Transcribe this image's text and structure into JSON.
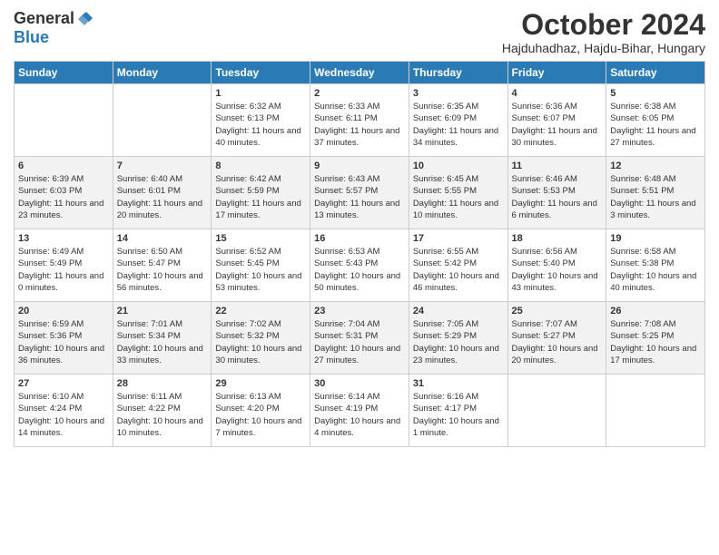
{
  "logo": {
    "general": "General",
    "blue": "Blue"
  },
  "title": {
    "month": "October 2024",
    "location": "Hajduhadhaz, Hajdu-Bihar, Hungary"
  },
  "days_of_week": [
    "Sunday",
    "Monday",
    "Tuesday",
    "Wednesday",
    "Thursday",
    "Friday",
    "Saturday"
  ],
  "weeks": [
    [
      {
        "date": "",
        "info": ""
      },
      {
        "date": "",
        "info": ""
      },
      {
        "date": "1",
        "info": "Sunrise: 6:32 AM\nSunset: 6:13 PM\nDaylight: 11 hours and 40 minutes."
      },
      {
        "date": "2",
        "info": "Sunrise: 6:33 AM\nSunset: 6:11 PM\nDaylight: 11 hours and 37 minutes."
      },
      {
        "date": "3",
        "info": "Sunrise: 6:35 AM\nSunset: 6:09 PM\nDaylight: 11 hours and 34 minutes."
      },
      {
        "date": "4",
        "info": "Sunrise: 6:36 AM\nSunset: 6:07 PM\nDaylight: 11 hours and 30 minutes."
      },
      {
        "date": "5",
        "info": "Sunrise: 6:38 AM\nSunset: 6:05 PM\nDaylight: 11 hours and 27 minutes."
      }
    ],
    [
      {
        "date": "6",
        "info": "Sunrise: 6:39 AM\nSunset: 6:03 PM\nDaylight: 11 hours and 23 minutes."
      },
      {
        "date": "7",
        "info": "Sunrise: 6:40 AM\nSunset: 6:01 PM\nDaylight: 11 hours and 20 minutes."
      },
      {
        "date": "8",
        "info": "Sunrise: 6:42 AM\nSunset: 5:59 PM\nDaylight: 11 hours and 17 minutes."
      },
      {
        "date": "9",
        "info": "Sunrise: 6:43 AM\nSunset: 5:57 PM\nDaylight: 11 hours and 13 minutes."
      },
      {
        "date": "10",
        "info": "Sunrise: 6:45 AM\nSunset: 5:55 PM\nDaylight: 11 hours and 10 minutes."
      },
      {
        "date": "11",
        "info": "Sunrise: 6:46 AM\nSunset: 5:53 PM\nDaylight: 11 hours and 6 minutes."
      },
      {
        "date": "12",
        "info": "Sunrise: 6:48 AM\nSunset: 5:51 PM\nDaylight: 11 hours and 3 minutes."
      }
    ],
    [
      {
        "date": "13",
        "info": "Sunrise: 6:49 AM\nSunset: 5:49 PM\nDaylight: 11 hours and 0 minutes."
      },
      {
        "date": "14",
        "info": "Sunrise: 6:50 AM\nSunset: 5:47 PM\nDaylight: 10 hours and 56 minutes."
      },
      {
        "date": "15",
        "info": "Sunrise: 6:52 AM\nSunset: 5:45 PM\nDaylight: 10 hours and 53 minutes."
      },
      {
        "date": "16",
        "info": "Sunrise: 6:53 AM\nSunset: 5:43 PM\nDaylight: 10 hours and 50 minutes."
      },
      {
        "date": "17",
        "info": "Sunrise: 6:55 AM\nSunset: 5:42 PM\nDaylight: 10 hours and 46 minutes."
      },
      {
        "date": "18",
        "info": "Sunrise: 6:56 AM\nSunset: 5:40 PM\nDaylight: 10 hours and 43 minutes."
      },
      {
        "date": "19",
        "info": "Sunrise: 6:58 AM\nSunset: 5:38 PM\nDaylight: 10 hours and 40 minutes."
      }
    ],
    [
      {
        "date": "20",
        "info": "Sunrise: 6:59 AM\nSunset: 5:36 PM\nDaylight: 10 hours and 36 minutes."
      },
      {
        "date": "21",
        "info": "Sunrise: 7:01 AM\nSunset: 5:34 PM\nDaylight: 10 hours and 33 minutes."
      },
      {
        "date": "22",
        "info": "Sunrise: 7:02 AM\nSunset: 5:32 PM\nDaylight: 10 hours and 30 minutes."
      },
      {
        "date": "23",
        "info": "Sunrise: 7:04 AM\nSunset: 5:31 PM\nDaylight: 10 hours and 27 minutes."
      },
      {
        "date": "24",
        "info": "Sunrise: 7:05 AM\nSunset: 5:29 PM\nDaylight: 10 hours and 23 minutes."
      },
      {
        "date": "25",
        "info": "Sunrise: 7:07 AM\nSunset: 5:27 PM\nDaylight: 10 hours and 20 minutes."
      },
      {
        "date": "26",
        "info": "Sunrise: 7:08 AM\nSunset: 5:25 PM\nDaylight: 10 hours and 17 minutes."
      }
    ],
    [
      {
        "date": "27",
        "info": "Sunrise: 6:10 AM\nSunset: 4:24 PM\nDaylight: 10 hours and 14 minutes."
      },
      {
        "date": "28",
        "info": "Sunrise: 6:11 AM\nSunset: 4:22 PM\nDaylight: 10 hours and 10 minutes."
      },
      {
        "date": "29",
        "info": "Sunrise: 6:13 AM\nSunset: 4:20 PM\nDaylight: 10 hours and 7 minutes."
      },
      {
        "date": "30",
        "info": "Sunrise: 6:14 AM\nSunset: 4:19 PM\nDaylight: 10 hours and 4 minutes."
      },
      {
        "date": "31",
        "info": "Sunrise: 6:16 AM\nSunset: 4:17 PM\nDaylight: 10 hours and 1 minute."
      },
      {
        "date": "",
        "info": ""
      },
      {
        "date": "",
        "info": ""
      }
    ]
  ]
}
